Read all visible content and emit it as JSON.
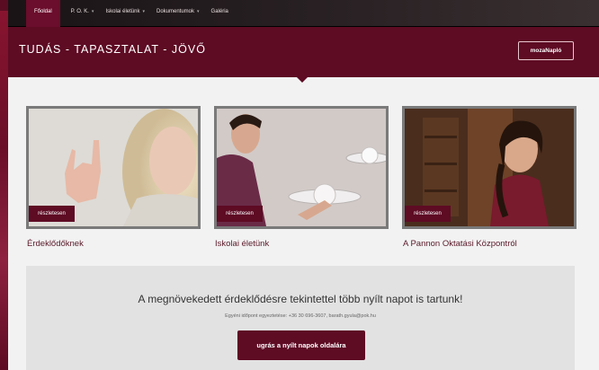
{
  "nav": {
    "items": [
      {
        "label": "Főoldal",
        "has_caret": false,
        "active": true
      },
      {
        "label": "P. O. K.",
        "has_caret": true,
        "active": false
      },
      {
        "label": "Iskolai életünk",
        "has_caret": true,
        "active": false
      },
      {
        "label": "Dokumentumok",
        "has_caret": true,
        "active": false
      },
      {
        "label": "Galéria",
        "has_caret": false,
        "active": false
      }
    ]
  },
  "header": {
    "title": "TUDÁS - TAPASZTALAT - JÖVŐ",
    "button_label": "mozaNapló"
  },
  "cards": [
    {
      "button_label": "részletesen",
      "caption": "Érdeklődőknek"
    },
    {
      "button_label": "részletesen",
      "caption": "Iskolai életünk"
    },
    {
      "button_label": "részletesen",
      "caption": "A Pannon Oktatási Központról"
    }
  ],
  "info": {
    "heading": "A megnövekedett érdeklődésre tekintettel több nyílt napot is tartunk!",
    "subtext": "Egyéni időpont egyeztetése: +36 30 696-3607, barath.gyula@pok.hu",
    "button_label": "ugrás a nyílt napok oldalára"
  },
  "colors": {
    "brand": "#5e0b24",
    "nav_bg": "#1a1416",
    "page_bg": "#f2f2f2",
    "panel_bg": "#e2e2e2"
  }
}
